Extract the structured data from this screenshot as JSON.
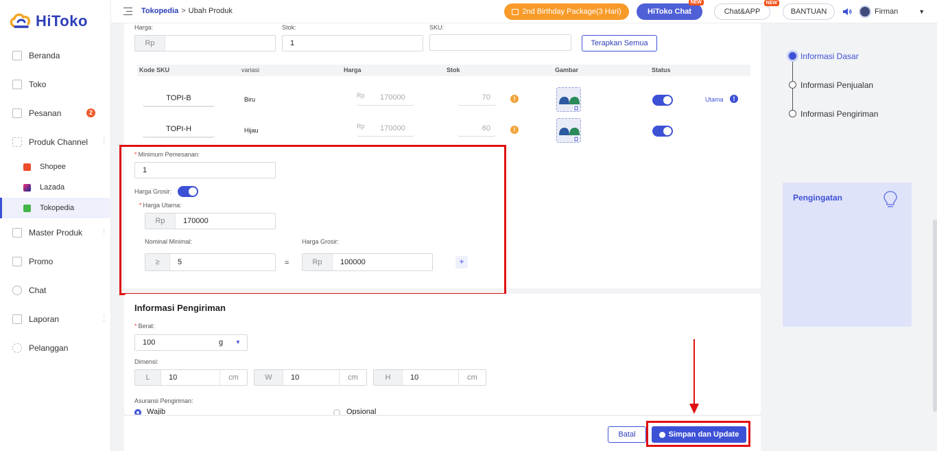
{
  "app": {
    "logo_text": "HiToko"
  },
  "sidebar": {
    "items": [
      {
        "label": "Beranda",
        "icon": "monitor-icon"
      },
      {
        "label": "Toko",
        "icon": "store-icon"
      },
      {
        "label": "Pesanan",
        "icon": "orders-icon",
        "badge": "2"
      },
      {
        "label": "Produk Channel",
        "icon": "grid-icon"
      },
      {
        "label": "Master Produk",
        "icon": "box-icon"
      },
      {
        "label": "Promo",
        "icon": "promo-icon"
      },
      {
        "label": "Chat",
        "icon": "chat-icon"
      },
      {
        "label": "Laporan",
        "icon": "report-icon"
      },
      {
        "label": "Pelanggan",
        "icon": "users-icon"
      }
    ],
    "channels": [
      {
        "label": "Shopee",
        "color": "#ee4d2d"
      },
      {
        "label": "Lazada",
        "color": "#1a2a8c"
      },
      {
        "label": "Tokopedia",
        "color": "#42b549"
      }
    ]
  },
  "topbar": {
    "breadcrumb_root": "Tokopedia",
    "breadcrumb_sep": ">",
    "breadcrumb_page": "Ubah Produk",
    "promo_label": "2nd Birthday Package(3 Hari)",
    "hitoko_chat_label": "HiToko Chat",
    "chat_app_label": "Chat&APP",
    "new_tag": "NEW",
    "help_label": "BANTUAN",
    "user_name": "Firman"
  },
  "bulk": {
    "harga_label": "Harga:",
    "stok_label": "Stok:",
    "sku_label": "SKU:",
    "currency": "Rp",
    "stok_value": "1",
    "apply_all_label": "Terapkan Semua"
  },
  "sku_table": {
    "headers": [
      "Kode SKU",
      "variasi",
      "Harga",
      "Stok",
      "Gambar",
      "Status"
    ],
    "rows": [
      {
        "code": "TOPI-B",
        "variant": "Biru",
        "currency": "Rp",
        "price": "170000",
        "stock": "70",
        "primary_label": "Utama"
      },
      {
        "code": "TOPI-H",
        "variant": "Hijau",
        "currency": "Rp",
        "price": "170000",
        "stock": "60"
      }
    ]
  },
  "wholesale": {
    "min_order_label": "Minimum Pemesanan:",
    "min_order_value": "1",
    "toggle_label": "Harga Grosir:",
    "main_price_label": "Harga Utama:",
    "currency": "Rp",
    "main_price_value": "170000",
    "min_qty_label": "Nominal Minimal:",
    "ge_symbol": "≥",
    "min_qty_value": "5",
    "equals": "=",
    "wholesale_price_label": "Harga Grosir:",
    "wholesale_price_value": "100000",
    "add_symbol": "+"
  },
  "shipping": {
    "title": "Informasi Pengiriman",
    "weight_label": "Berat:",
    "weight_value": "100",
    "weight_unit": "g",
    "dimension_label": "Dimensi:",
    "dims": [
      {
        "axis": "L",
        "value": "10",
        "unit": "cm"
      },
      {
        "axis": "W",
        "value": "10",
        "unit": "cm"
      },
      {
        "axis": "H",
        "value": "10",
        "unit": "cm"
      }
    ],
    "insurance_label": "Asuransi Pengiriman:",
    "insurance_required": "Wajib",
    "insurance_optional": "Opsional"
  },
  "footer": {
    "cancel_label": "Batal",
    "save_label": "Simpan dan Update"
  },
  "steps": [
    {
      "label": "Informasi Dasar",
      "active": true
    },
    {
      "label": "Informasi Penjualan",
      "active": false
    },
    {
      "label": "Informasi Pengiriman",
      "active": false
    }
  ],
  "reminder": {
    "title": "Pengingatan"
  },
  "colors": {
    "accent": "#3d51d6",
    "highlight": "#e01010",
    "promo": "#f89b2a"
  }
}
